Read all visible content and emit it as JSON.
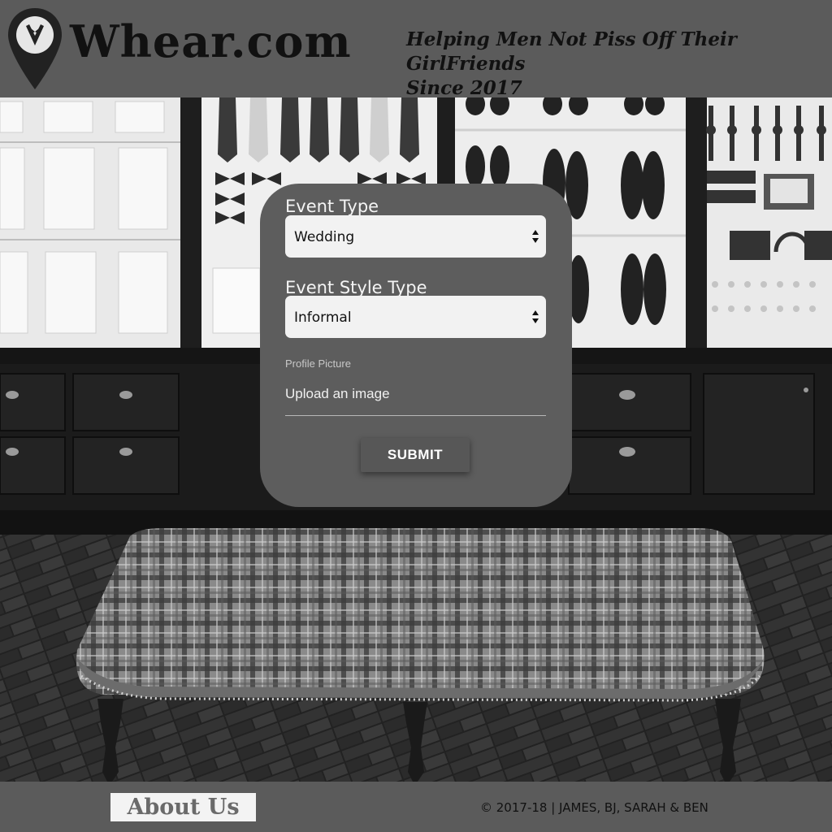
{
  "header": {
    "brand": "Whear.com",
    "tagline_line1": "Helping Men Not Piss Off Their GirlFriends",
    "tagline_line2": "Since 2017"
  },
  "form": {
    "event_type_label": "Event Type",
    "event_type_value": "Wedding",
    "event_style_label": "Event Style Type",
    "event_style_value": "Informal",
    "profile_picture_label": "Profile Picture",
    "upload_text": "Upload an image",
    "submit_label": "SUBMIT"
  },
  "footer": {
    "about_label": "About Us",
    "copyright": "© 2017-18 | JAMES, BJ, SARAH & BEN"
  },
  "colors": {
    "header_bg": "#5b5b5b",
    "card_bg": "#5d5d5d",
    "select_bg": "#f2f2f2"
  },
  "icons": {
    "logo": "map-pin-tuxedo-icon",
    "select_caret": "up-down-caret-icon"
  }
}
